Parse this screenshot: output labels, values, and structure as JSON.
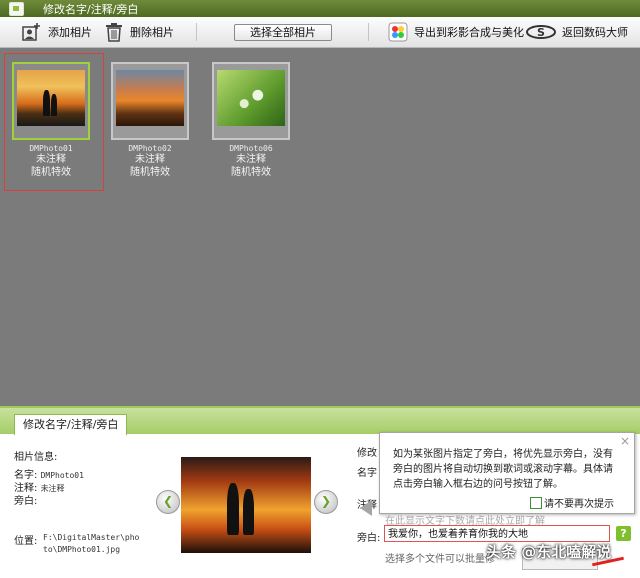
{
  "window": {
    "title": "修改名字/注释/旁白"
  },
  "toolbar": {
    "add_photo": "添加相片",
    "delete_photo": "删除相片",
    "select_all": "选择全部相片",
    "export": "导出到彩影合成与美化",
    "back": "返回数码大师"
  },
  "photos": [
    {
      "name": "DMPhoto01",
      "comment": "未注释",
      "effect": "随机特效"
    },
    {
      "name": "DMPhoto02",
      "comment": "未注释",
      "effect": "随机特效"
    },
    {
      "name": "DMPhoto06",
      "comment": "未注释",
      "effect": "随机特效"
    }
  ],
  "panel": {
    "tab": "修改名字/注释/旁白",
    "info_title": "相片信息:",
    "name_label": "名字:",
    "name_value": "DMPhoto01",
    "comment_label": "注释:",
    "comment_value": "未注释",
    "narration_label": "旁白:",
    "location_label": "位置:",
    "location_value": "F:\\DigitalMaster\\photo\\DMPhoto01.jpg",
    "right_edit_label": "修改",
    "right_name_label": "名字",
    "right_comment_label": "注释",
    "narration_field_label": "旁白:",
    "narration_value": "我爱你，也爱着养育你我的大地",
    "help_symbol": "?",
    "batch_hint": "选择多个文件可以批量修",
    "faded_hint": "在此显示文字下数请点此处立即了解"
  },
  "tooltip": {
    "text": "如为某张图片指定了旁白，将优先显示旁白，没有旁白的图片将自动切换到歌词或滚动字幕。具体请点击旁白输入框右边的问号按钮了解。",
    "checkbox_label": "请不要再次提示",
    "close_symbol": "×"
  },
  "watermark": "头条 @东北嗑解说",
  "colors": {
    "accent_green": "#9ec857",
    "selection_red": "#d94040"
  }
}
